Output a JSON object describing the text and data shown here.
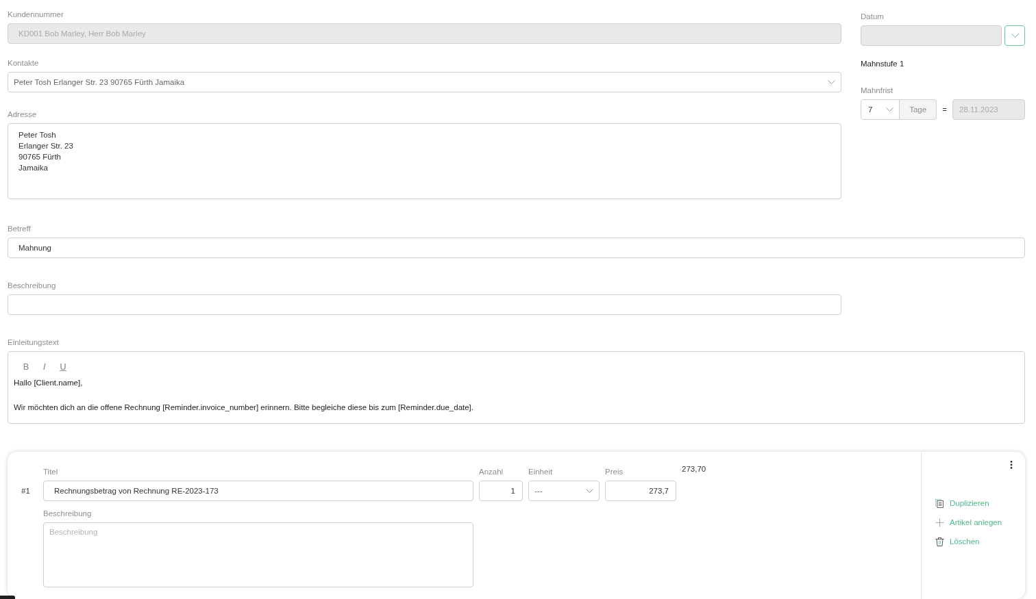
{
  "form": {
    "customer_number": {
      "label": "Kundennummer",
      "value": "KD001 Bob Marley, Herr Bob Marley",
      "disabled": true
    },
    "contacts": {
      "label": "Kontakte",
      "value": "Peter Tosh Erlanger Str. 23 90765 Fürth Jamaika"
    },
    "address": {
      "label": "Adresse",
      "lines": [
        "Peter Tosh",
        "Erlanger Str. 23",
        "90765 Fürth",
        "Jamaika"
      ]
    },
    "subject": {
      "label": "Betreff",
      "value": "Mahnung"
    },
    "description": {
      "label": "Beschreibung"
    },
    "intro_text": {
      "label": "Einleitungstext",
      "toolbar": [
        {
          "kind": "bold",
          "label": "B"
        },
        {
          "kind": "italic",
          "label": "I"
        },
        {
          "kind": "underline",
          "label": "U"
        }
      ],
      "paragraphs": [
        "Hallo [Client.name],",
        "Wir möchten dich an die offene Rechnung [Reminder.invoice_number] erinnern. Bitte begleiche diese bis zum [Reminder.due_date]."
      ]
    }
  },
  "sidebar": {
    "date": {
      "label": "Datum",
      "disabled": true
    },
    "reminder_level": "Mahnstufe 1",
    "deadline": {
      "label": "Mahnfrist",
      "days": "7",
      "unit": "Tage",
      "equals": "=",
      "due_date": {
        "value": "28.11.2023",
        "disabled": true
      }
    }
  },
  "items": [
    {
      "number": "#1",
      "title": {
        "label": "Titel",
        "value": "Rechnungsbetrag von Rechnung RE-2023-173"
      },
      "quantity": {
        "label": "Anzahl",
        "value": "1"
      },
      "unit": {
        "label": "Einheit",
        "value": "---"
      },
      "price": {
        "label": "Preis",
        "value": "273,7"
      },
      "total": "273,70",
      "description": {
        "label": "Beschreibung",
        "placeholder": "Beschreibung"
      },
      "actions": [
        {
          "kind": "duplicate",
          "label": "Duplizieren"
        },
        {
          "kind": "add",
          "label": "Artikel anlegen"
        },
        {
          "kind": "delete",
          "label": "Löschen"
        }
      ]
    }
  ]
}
